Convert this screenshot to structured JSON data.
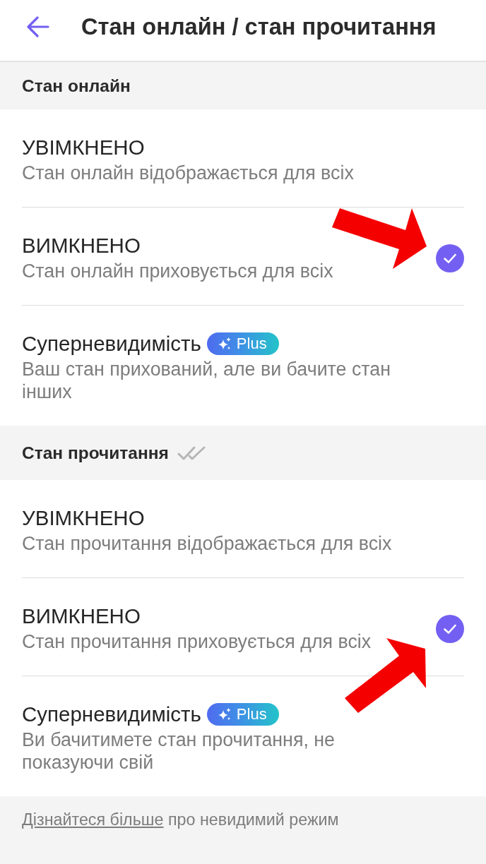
{
  "header": {
    "title": "Стан онлайн / стан прочитання"
  },
  "sections": [
    {
      "title": "Стан онлайн",
      "status_icon": false,
      "options": [
        {
          "title": "УВІМКНЕНО",
          "subtitle": "Стан онлайн відображається для всіх",
          "selected": false
        },
        {
          "title": "ВИМКНЕНО",
          "subtitle": "Стан онлайн приховується для всіх",
          "selected": true,
          "annotation": {
            "kind": "arrow-from-upper-left"
          }
        },
        {
          "title": "Суперневидимість",
          "badge": "Plus",
          "subtitle": "Ваш стан прихований, але ви бачите стан інших",
          "selected": false
        }
      ]
    },
    {
      "title": "Стан прочитання",
      "status_icon": true,
      "options": [
        {
          "title": "УВІМКНЕНО",
          "subtitle": "Стан прочитання відображається для всіх",
          "selected": false
        },
        {
          "title": "ВИМКНЕНО",
          "subtitle": "Стан прочитання приховується для всіх",
          "selected": true,
          "annotation": {
            "kind": "arrow-from-lower-left"
          }
        },
        {
          "title": "Суперневидимість",
          "badge": "Plus",
          "subtitle": "Ви бачитимете стан прочитання, не показуючи свій",
          "selected": false
        }
      ]
    }
  ],
  "footer": {
    "link": "Дізнайтеся більше",
    "text": "про невидимий режим"
  }
}
